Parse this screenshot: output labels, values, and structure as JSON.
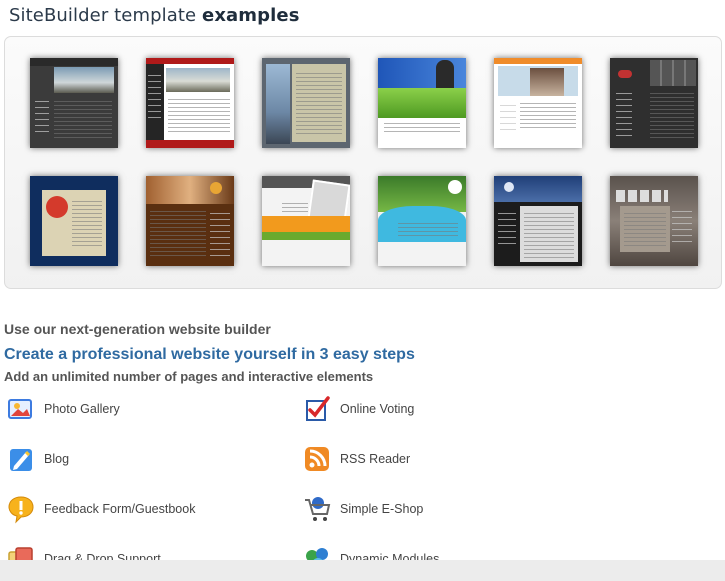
{
  "header": {
    "title_main": "SiteBuilder template ",
    "title_bold": "examples"
  },
  "templates": [
    {
      "label": "Dark template",
      "colors": [
        "#3b3b3b",
        "#222"
      ]
    },
    {
      "label": "Red template",
      "colors": [
        "#f0f0f0",
        "#b01a1a"
      ]
    },
    {
      "label": "Gray city template",
      "colors": [
        "#5d6670",
        "#c9c5a8"
      ]
    },
    {
      "label": "Blue green template",
      "colors": [
        "#1f56b8",
        "#6cbf3a"
      ]
    },
    {
      "label": "Light blue template",
      "colors": [
        "#e9eef4",
        "#f08c2a"
      ]
    },
    {
      "label": "Dark grid template",
      "colors": [
        "#2f2f2f",
        "#191919"
      ]
    },
    {
      "label": "Navy flower template",
      "colors": [
        "#0f2d5e",
        "#dcd3b4"
      ]
    },
    {
      "label": "Brown template",
      "colors": [
        "#5a2f10",
        "#2b1808"
      ]
    },
    {
      "label": "Orange green template",
      "colors": [
        "#f3f3f3",
        "#f29a1d"
      ]
    },
    {
      "label": "Cyan nature template",
      "colors": [
        "#3fb9e0",
        "#f3f3f3"
      ]
    },
    {
      "label": "Navy dark template",
      "colors": [
        "#1d3a6e",
        "#1c1c1c"
      ]
    },
    {
      "label": "Sepia template",
      "colors": [
        "#6f6560",
        "#a49a8e"
      ]
    }
  ],
  "intro": {
    "line1": "Use our next-generation website builder",
    "line2": "Create a professional website yourself in 3 easy steps",
    "line3": "Add an unlimited number of pages and interactive elements"
  },
  "features": [
    {
      "label": "Photo Gallery",
      "icon": "photo-gallery-icon"
    },
    {
      "label": "Online Voting",
      "icon": "online-voting-icon"
    },
    {
      "label": "Blog",
      "icon": "blog-icon"
    },
    {
      "label": "RSS Reader",
      "icon": "rss-icon"
    },
    {
      "label": "Feedback Form/Guestbook",
      "icon": "feedback-icon"
    },
    {
      "label": "Simple E-Shop",
      "icon": "shopping-cart-icon"
    },
    {
      "label": "Drag & Drop Support",
      "icon": "drag-drop-icon"
    },
    {
      "label": "Dynamic Modules",
      "icon": "dynamic-modules-icon"
    }
  ],
  "colors": {
    "accent_blue": "#2f6aa1",
    "title": "#2b3a4a",
    "text": "#444444"
  }
}
